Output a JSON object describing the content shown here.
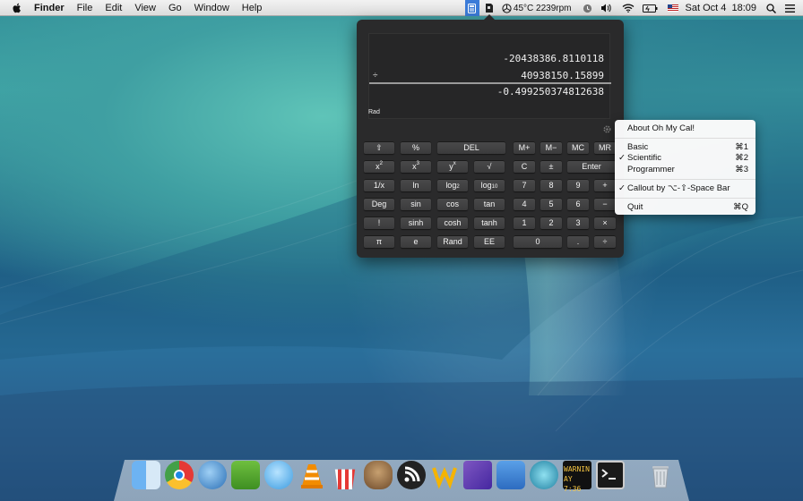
{
  "menubar": {
    "app_name": "Finder",
    "menus": [
      "File",
      "Edit",
      "View",
      "Go",
      "Window",
      "Help"
    ],
    "status": {
      "temp_fan": "45°C 2239rpm",
      "date_time": "Sat Oct 4  18:09"
    }
  },
  "calculator": {
    "display": {
      "line1": "-20438386.8110118",
      "operator": "÷",
      "line2": "40938150.15899",
      "result": "-0.499250374812638"
    },
    "angle_mode": "Rad",
    "buttons": {
      "shift": "⇧",
      "percent": "%",
      "del": "DEL",
      "m_plus": "M+",
      "m_minus": "M−",
      "mc": "MC",
      "mr": "MR",
      "x2_base": "x",
      "x2_exp": "2",
      "x3_base": "x",
      "x3_exp": "3",
      "yx_base": "y",
      "yx_exp": "x",
      "sqrt": "√",
      "clear": "C",
      "plusminus": "±",
      "enter": "Enter",
      "reciprocal": "1/x",
      "ln": "ln",
      "log2_base": "log",
      "log2_sub": "2",
      "log10_base": "log",
      "log10_sub": "10",
      "n7": "7",
      "n8": "8",
      "n9": "9",
      "plus": "+",
      "deg": "Deg",
      "sin": "sin",
      "cos": "cos",
      "tan": "tan",
      "n4": "4",
      "n5": "5",
      "n6": "6",
      "minus": "−",
      "fact": "!",
      "sinh": "sinh",
      "cosh": "cosh",
      "tanh": "tanh",
      "n1": "1",
      "n2": "2",
      "n3": "3",
      "times": "×",
      "pi": "π",
      "e": "e",
      "rand": "Rand",
      "ee": "EE",
      "n0": "0",
      "dot": ".",
      "divide": "÷"
    }
  },
  "app_menu": {
    "about": "About Oh My Cal!",
    "basic": "Basic",
    "basic_sc": "⌘1",
    "scientific": "Scientific",
    "scientific_sc": "⌘2",
    "programmer": "Programmer",
    "programmer_sc": "⌘3",
    "callout": "Callout by ⌥-⇧-Space Bar",
    "quit": "Quit",
    "quit_sc": "⌘Q",
    "check": "✓"
  },
  "dock": {
    "warning_text": "WARNIN",
    "warning_time": "AY 7:36"
  }
}
